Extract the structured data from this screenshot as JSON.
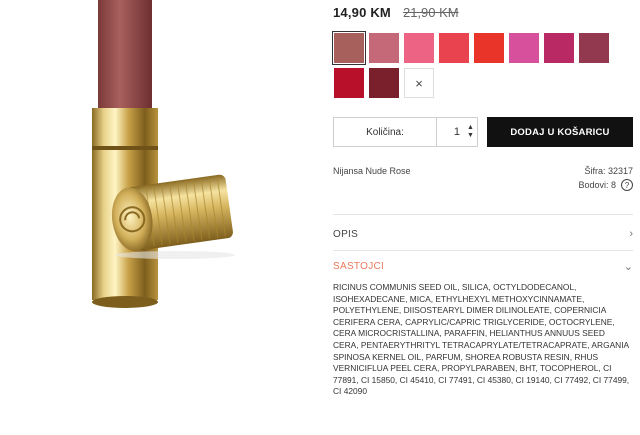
{
  "price": {
    "current": "14,90 KM",
    "old": "21,90 KM"
  },
  "swatches": [
    {
      "color": "#a8605d",
      "selected": true
    },
    {
      "color": "#c56877"
    },
    {
      "color": "#ec6383"
    },
    {
      "color": "#e8434f"
    },
    {
      "color": "#e83429"
    },
    {
      "color": "#d6509c"
    },
    {
      "color": "#b92a64"
    },
    {
      "color": "#93394f"
    },
    {
      "color": "#b8102a"
    },
    {
      "color": "#7a1f2c"
    }
  ],
  "clear_swatch": {
    "symbol": "×",
    "icon": "close-icon"
  },
  "quantity": {
    "label": "Količina:",
    "value": "1"
  },
  "add_to_cart": {
    "label": "DODAJ U KOŠARICU"
  },
  "product": {
    "shade": "Nijansa Nude Rose",
    "sku": "Šifra: 32317",
    "points": "Bodovi: 8"
  },
  "accordion": {
    "description": {
      "title": "OPIS",
      "icon": "chevron-right-icon"
    },
    "ingredients": {
      "title": "SASTOJCI",
      "icon": "chevron-down-icon",
      "text": "RICINUS COMMUNIS SEED OIL, SILICA, OCTYLDODECANOL, ISOHEXADECANE, MICA, ETHYLHEXYL METHOXYCINNAMATE, POLYETHYLENE, DIISOSTEARYL DIMER DILINOLEATE, COPERNICIA CERIFERA CERA, CAPRYLIC/CAPRIC TRIGLYCERIDE, OCTOCRYLENE, CERA MICROCRISTALLINA, PARAFFIN, HELIANTHUS ANNUUS SEED CERA, PENTAERYTHRITYL TETRACAPRYLATE/TETRACAPRATE, ARGANIA SPINOSA KERNEL OIL, PARFUM, SHOREA ROBUSTA RESIN, RHUS VERNICIFLUA PEEL CERA, PROPYLPARABEN, BHT, TOCOPHEROL, CI 77891, CI 15850, CI 45410, CI 77491, CI 45380, CI 19140, CI 77492, CI 77499, CI 42090"
    }
  },
  "colors": {
    "accent": "#e87a5d",
    "button": "#111111"
  }
}
